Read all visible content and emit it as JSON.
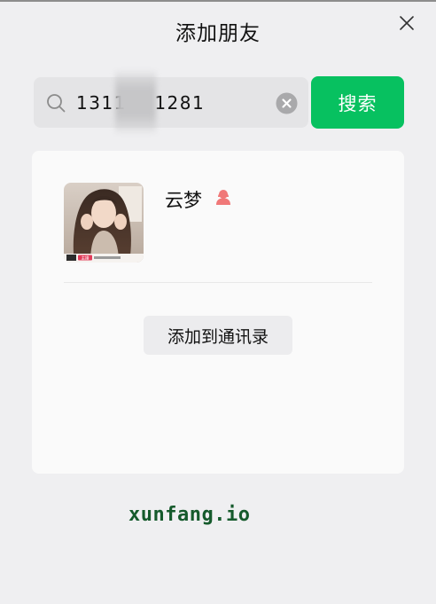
{
  "dialog": {
    "title": "添加朋友",
    "close_icon": "close-icon"
  },
  "search": {
    "value": "1311    1281",
    "icon": "search-icon",
    "clear_icon": "clear-icon",
    "button_label": "搜索"
  },
  "result": {
    "name": "云梦",
    "gender_icon": "female-person-icon",
    "avatar_badge": "主播",
    "add_button_label": "添加到通讯录"
  },
  "watermark": {
    "text": "xunfang.io"
  },
  "colors": {
    "accent": "#07c160",
    "background": "#efeff1",
    "card": "#fafafa",
    "gender_female": "#f07878",
    "watermark": "#155a2c"
  }
}
